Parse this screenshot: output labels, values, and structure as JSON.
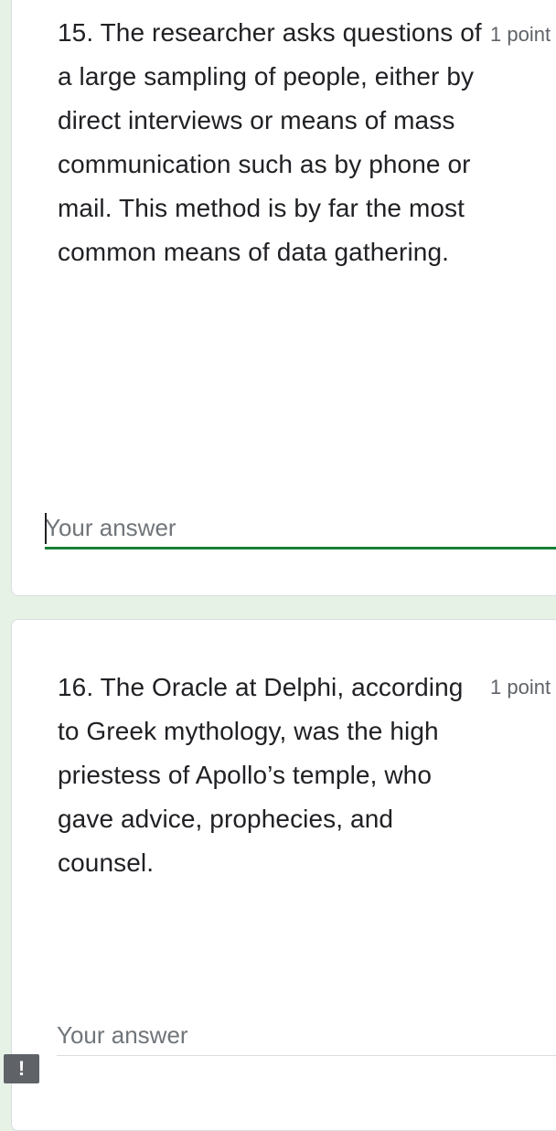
{
  "questions": [
    {
      "text": "15. The researcher asks questions of a large sampling of people, either by direct interviews or means of mass communication such as by phone or mail. This method is by far the most common means of data gathering.",
      "points": "1 point",
      "answer_placeholder": "Your answer",
      "answer_value": ""
    },
    {
      "text": "16. The Oracle at Delphi, according to Greek mythology, was the high priestess of Apollo’s temple, who gave advice, prophecies, and counsel.",
      "points": "1 point",
      "answer_placeholder": "Your answer",
      "answer_value": ""
    }
  ],
  "feedback_button": {
    "icon": "exclamation-icon",
    "symbol": "!"
  },
  "colors": {
    "background": "#e6f2e6",
    "focus_underline": "#188038"
  }
}
